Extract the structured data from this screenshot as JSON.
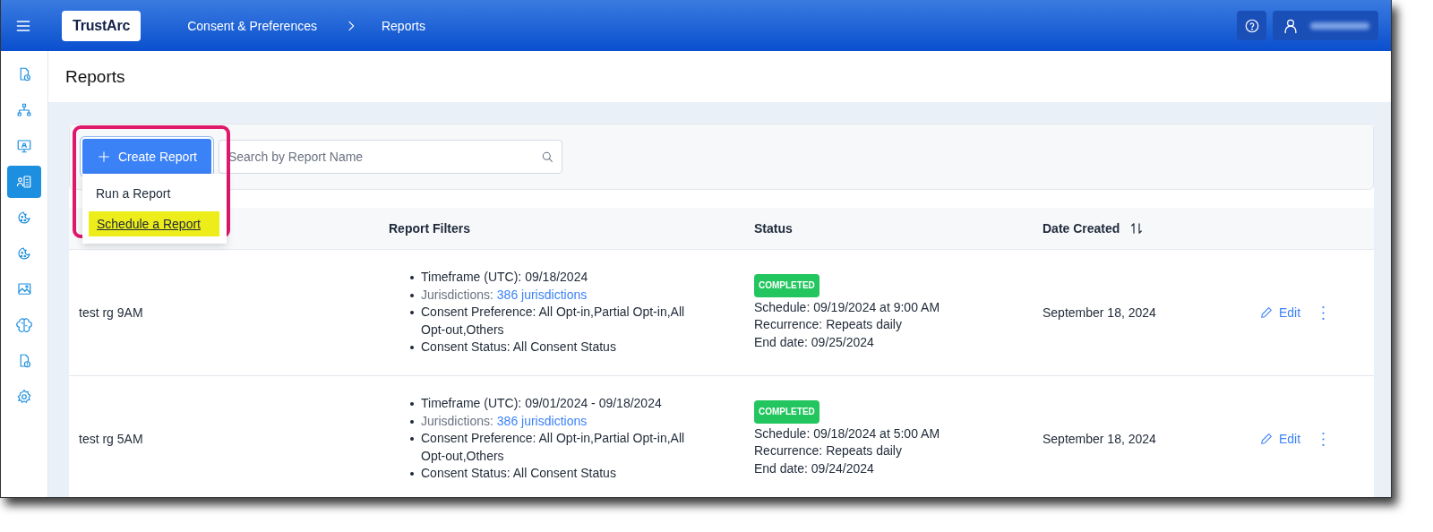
{
  "header": {
    "logo": "TrustArc",
    "breadcrumb": [
      "Consent & Preferences",
      "Reports"
    ]
  },
  "sidebar": {
    "items": [
      {
        "selected": false
      },
      {
        "selected": false
      },
      {
        "selected": false
      },
      {
        "selected": true
      },
      {
        "selected": false
      },
      {
        "selected": false
      },
      {
        "selected": false
      },
      {
        "selected": false
      },
      {
        "selected": false
      },
      {
        "selected": false
      }
    ]
  },
  "page": {
    "title": "Reports"
  },
  "toolbar": {
    "create_button": "Create Report",
    "search": {
      "placeholder": "Search by Report Name"
    }
  },
  "create_menu": {
    "annotated": true,
    "items": [
      {
        "label": "Run a Report",
        "highlighted": false
      },
      {
        "label": "Schedule a Report",
        "highlighted": true
      }
    ]
  },
  "table": {
    "columns": [
      {
        "label": "Report Filters",
        "sortable": false
      },
      {
        "label": "Status",
        "sortable": false
      },
      {
        "label": "Date Created",
        "sortable": true
      }
    ],
    "rows": [
      {
        "name": "test rg 9AM",
        "filters": [
          {
            "kind": "text",
            "text": "Timeframe (UTC): 09/18/2024"
          },
          {
            "kind": "link",
            "text": "Jurisdictions:",
            "link": "386 jurisdictions"
          },
          {
            "kind": "text",
            "text": "Consent Preference: All Opt-in,Partial Opt-in,All Opt-out,Others"
          },
          {
            "kind": "text",
            "text": "Consent Status: All Consent Status"
          }
        ],
        "status": "COMPLETED",
        "schedule": [
          "Schedule: 09/19/2024 at 9:00 AM",
          "Recurrence: Repeats daily",
          "End date: 09/25/2024"
        ],
        "date": "September 18, 2024",
        "action": "Edit"
      },
      {
        "name": "test rg 5AM",
        "filters": [
          {
            "kind": "text",
            "text": "Timeframe (UTC): 09/01/2024 - 09/18/2024"
          },
          {
            "kind": "link",
            "text": "Jurisdictions:",
            "link": "386 jurisdictions"
          },
          {
            "kind": "text",
            "text": "Consent Preference: All Opt-in,Partial Opt-in,All Opt-out,Others"
          },
          {
            "kind": "text",
            "text": "Consent Status: All Consent Status"
          }
        ],
        "status": "COMPLETED",
        "schedule": [
          "Schedule: 09/18/2024 at 5:00 AM",
          "Recurrence: Repeats daily",
          "End date: 09/24/2024"
        ],
        "date": "September 18, 2024",
        "action": "Edit"
      }
    ]
  }
}
